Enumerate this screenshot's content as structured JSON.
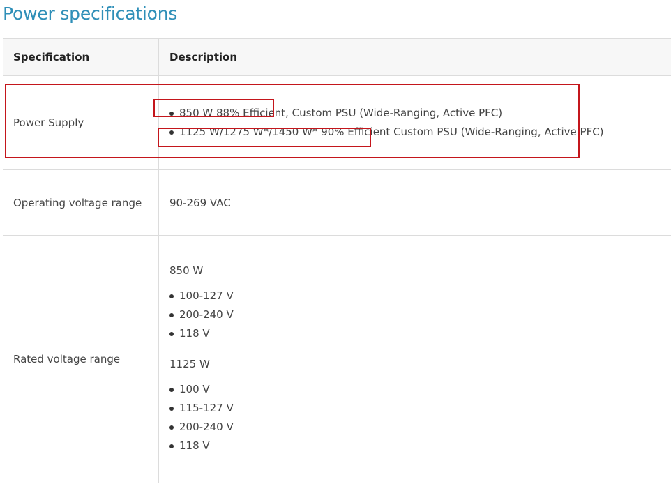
{
  "page": {
    "title": "Power specifications"
  },
  "table": {
    "headers": {
      "specification": "Specification",
      "description": "Description"
    },
    "rows": {
      "power_supply": {
        "label": "Power Supply",
        "items": [
          {
            "text": "850 W 88% Efficient, Custom PSU (Wide-Ranging, Active PFC)"
          },
          {
            "text": "1125 W/1275 W*/1450 W* 90% Efficient Custom PSU (Wide-Ranging, Active PFC)"
          }
        ]
      },
      "operating_voltage": {
        "label": "Operating voltage range",
        "value": "90-269 VAC"
      },
      "rated_voltage": {
        "label": "Rated voltage range",
        "groups": [
          {
            "heading": "850 W",
            "items": [
              "100-127 V",
              "200-240 V",
              "118 V"
            ]
          },
          {
            "heading": "1125 W",
            "items": [
              "100 V",
              "115-127 V",
              "200-240 V",
              "118 V"
            ]
          }
        ]
      }
    }
  },
  "annotations": {
    "color": "#c4161c"
  },
  "colors": {
    "title": "#2f8fb8",
    "border": "#dcdcdc",
    "header_bg": "#f7f7f7"
  }
}
